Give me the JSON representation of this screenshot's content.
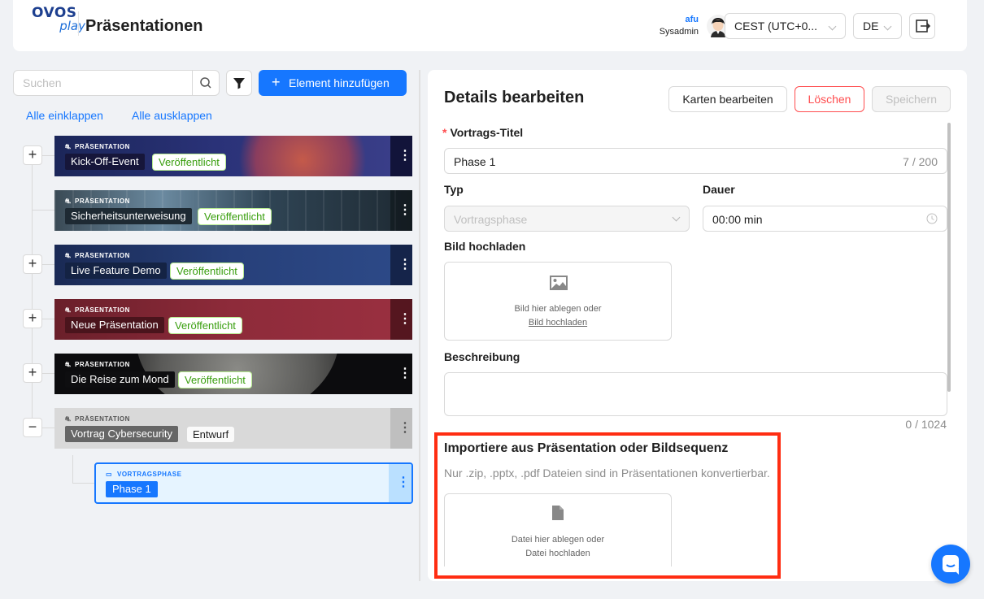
{
  "header": {
    "logo_top": "OVOS",
    "logo_bottom": "play",
    "title": "Präsentationen",
    "user_name": "afu",
    "user_role": "Sysadmin",
    "timezone": "CEST (UTC+0...",
    "language": "DE"
  },
  "sidebar": {
    "search_placeholder": "Suchen",
    "add_button": "Element hinzufügen",
    "collapse_all": "Alle einklappen",
    "expand_all": "Alle ausklappen",
    "items": [
      {
        "kind": "PRÄSENTATION",
        "title": "Kick-Off-Event",
        "status": "Veröffentlicht",
        "toggle": "+"
      },
      {
        "kind": "PRÄSENTATION",
        "title": "Sicherheitsunterweisung",
        "status": "Veröffentlicht",
        "toggle": ""
      },
      {
        "kind": "PRÄSENTATION",
        "title": "Live Feature Demo",
        "status": "Veröffentlicht",
        "toggle": "+"
      },
      {
        "kind": "PRÄSENTATION",
        "title": "Neue Präsentation",
        "status": "Veröffentlicht",
        "toggle": "+"
      },
      {
        "kind": "PRÄSENTATION",
        "title": "Die Reise zum Mond",
        "status": "Veröffentlicht",
        "toggle": "+"
      },
      {
        "kind": "PRÄSENTATION",
        "title": "Vortrag Cybersecurity",
        "status": "Entwurf",
        "toggle": "−"
      }
    ],
    "child": {
      "kind": "VORTRAGSPHASE",
      "title": "Phase 1"
    }
  },
  "details": {
    "title": "Details bearbeiten",
    "edit_cards": "Karten bearbeiten",
    "delete": "Löschen",
    "save": "Speichern",
    "talk_title_label": "Vortrags-Titel",
    "talk_title_value": "Phase 1",
    "talk_title_count": "7 / 200",
    "type_label": "Typ",
    "type_value": "Vortragsphase",
    "duration_label": "Dauer",
    "duration_value": "00:00 min",
    "image_label": "Bild hochladen",
    "image_drop": "Bild hier ablegen oder",
    "image_link": "Bild hochladen",
    "desc_label": "Beschreibung",
    "desc_count": "0 / 1024",
    "import_title": "Importiere aus Präsentation oder Bildsequenz",
    "import_hint": "Nur .zip, .pptx, .pdf Dateien sind in Präsentationen konvertierbar.",
    "file_drop": "Datei hier ablegen oder",
    "file_link": "Datei hochladen"
  },
  "colors": {
    "primary": "#1677ff",
    "danger": "#ff4d4f",
    "highlight": "#ff2d12",
    "published": "#389e0d"
  }
}
